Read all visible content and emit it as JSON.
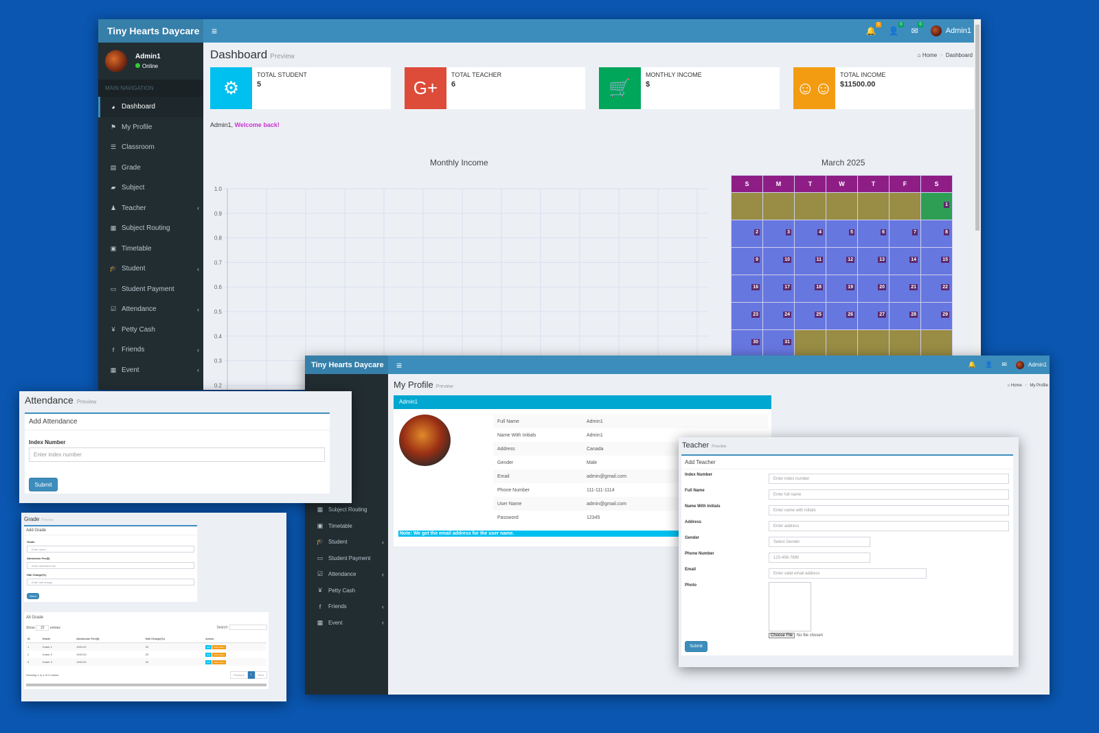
{
  "brand": "Tiny Hearts Daycare",
  "user": {
    "name": "Admin1",
    "status": "Online"
  },
  "header": {
    "notifications_badge": "0",
    "users_badge": "0",
    "messages_badge": "0",
    "user_label": "Admin1"
  },
  "sidebar": {
    "section_title": "MAIN NAVIGATION",
    "items": [
      {
        "label": "Dashboard",
        "icon": "dashboard-icon",
        "glyph": "◕",
        "caret": false
      },
      {
        "label": "My Profile",
        "icon": "flag-icon",
        "glyph": "⚑",
        "caret": false
      },
      {
        "label": "Classroom",
        "icon": "list-icon",
        "glyph": "☰",
        "caret": false
      },
      {
        "label": "Grade",
        "icon": "database-icon",
        "glyph": "▤",
        "caret": false
      },
      {
        "label": "Subject",
        "icon": "book-icon",
        "glyph": "▰",
        "caret": false
      },
      {
        "label": "Teacher",
        "icon": "user-icon",
        "glyph": "♟",
        "caret": true
      },
      {
        "label": "Subject Routing",
        "icon": "grid-icon",
        "glyph": "▦",
        "caret": false
      },
      {
        "label": "Timetable",
        "icon": "calendar-plus-icon",
        "glyph": "▣",
        "caret": false
      },
      {
        "label": "Student",
        "icon": "graduation-cap-icon",
        "glyph": "🎓",
        "caret": true
      },
      {
        "label": "Student Payment",
        "icon": "money-icon",
        "glyph": "▭",
        "caret": false
      },
      {
        "label": "Attendance",
        "icon": "calendar-check-icon",
        "glyph": "☑",
        "caret": true
      },
      {
        "label": "Petty Cash",
        "icon": "yen-icon",
        "glyph": "¥",
        "caret": false
      },
      {
        "label": "Friends",
        "icon": "facebook-icon",
        "glyph": "f",
        "caret": true
      },
      {
        "label": "Event",
        "icon": "calendar-icon",
        "glyph": "▦",
        "caret": true
      }
    ]
  },
  "dashboard": {
    "title": "Dashboard",
    "subtitle": "Preview",
    "breadcrumb": [
      "Home",
      "Dashboard"
    ],
    "info_boxes": [
      {
        "label": "TOTAL STUDENT",
        "value": "5",
        "color": "#00c0ef",
        "icon": "gear-icon",
        "glyph": "⚙"
      },
      {
        "label": "TOTAL TEACHER",
        "value": "6",
        "color": "#dd4b39",
        "icon": "google-plus-icon",
        "glyph": "G+"
      },
      {
        "label": "MONTHLY INCOME",
        "value": "$",
        "color": "#00a65a",
        "icon": "shopping-cart-icon",
        "glyph": "🛒"
      },
      {
        "label": "TOTAL INCOME",
        "value": "$11500.00",
        "color": "#f39c12",
        "icon": "users-icon",
        "glyph": "☺☺"
      }
    ],
    "welcome_name": "Admin1,",
    "welcome_text": "Welcome back!"
  },
  "chart_data": {
    "type": "line",
    "title": "Monthly Income",
    "xlabel": "",
    "ylabel": "",
    "ylim": [
      0,
      1.0
    ],
    "y_ticks": [
      "1.0",
      "0.9",
      "0.8",
      "0.7",
      "0.6",
      "0.5",
      "0.4",
      "0.3",
      "0.2"
    ],
    "series": [],
    "grid": true
  },
  "calendar": {
    "title": "March 2025",
    "weekdays": [
      "S",
      "M",
      "T",
      "W",
      "T",
      "F",
      "S"
    ],
    "first_weekday": 6,
    "days": 31,
    "today": 1
  },
  "attendance": {
    "title": "Attendance",
    "subtitle": "Preview",
    "panel_title": "Add Attendance",
    "field_label": "Index Number",
    "placeholder": "Enter index number",
    "submit": "Submit"
  },
  "grade": {
    "title": "Grade",
    "subtitle": "Preview",
    "panel_title": "Add Grade",
    "fields": [
      {
        "label": "Grade",
        "placeholder": "Enter name"
      },
      {
        "label": "Admission Fee($)",
        "placeholder": "Enter admission fee"
      },
      {
        "label": "Hall Charge(%)",
        "placeholder": "Enter hall charge"
      }
    ],
    "submit": "Send",
    "list_title": "All Grade",
    "show": "Show",
    "entries_value": "10",
    "entries": "entries",
    "search": "Search:",
    "columns": [
      "ID",
      "Grade",
      "Admission Fee($)",
      "Hall Charge(%)",
      "Action"
    ],
    "rows": [
      [
        "1",
        "Grade 1",
        "1000.00",
        "25"
      ],
      [
        "2",
        "Grade 2",
        "1000.00",
        "25"
      ],
      [
        "3",
        "Grade 3",
        "1000.00",
        "20"
      ]
    ],
    "edit": "Edit",
    "view": "View others",
    "footer": "Showing 1 to 3 of 3 entries",
    "prev": "Previous",
    "page": "1",
    "next": "Next"
  },
  "profile": {
    "title": "My Profile",
    "subtitle": "Preview",
    "breadcrumb": [
      "Home",
      "My Profile"
    ],
    "panel_title": "Admin1",
    "fields": [
      [
        "Full Name",
        "Admin1"
      ],
      [
        "Name With Initials",
        "Admin1"
      ],
      [
        "Address",
        "Canada"
      ],
      [
        "Gender",
        "Male"
      ],
      [
        "Email",
        "admin@gmail.com"
      ],
      [
        "Phone Number",
        "111-111-1114"
      ],
      [
        "User Name",
        "admin@gmail.com"
      ],
      [
        "Password",
        "12345"
      ]
    ],
    "note": "Note: We get the email address for the user name."
  },
  "teacher": {
    "title": "Teacher",
    "subtitle": "Preview",
    "panel_title": "Add Teacher",
    "fields": [
      {
        "label": "Index Number",
        "placeholder": "Enter index number"
      },
      {
        "label": "Full Name",
        "placeholder": "Enter full name"
      },
      {
        "label": "Name With Initials",
        "placeholder": "Enter name with initials"
      },
      {
        "label": "Address",
        "placeholder": "Enter address"
      },
      {
        "label": "Gender",
        "placeholder": "Select Gender"
      },
      {
        "label": "Phone Number",
        "placeholder": "123-456-7890"
      },
      {
        "label": "Email",
        "placeholder": "Enter valid email address"
      },
      {
        "label": "Photo",
        "placeholder": ""
      }
    ],
    "choose_file": "Choose File",
    "no_file": "No file chosen",
    "submit": "Submit"
  }
}
